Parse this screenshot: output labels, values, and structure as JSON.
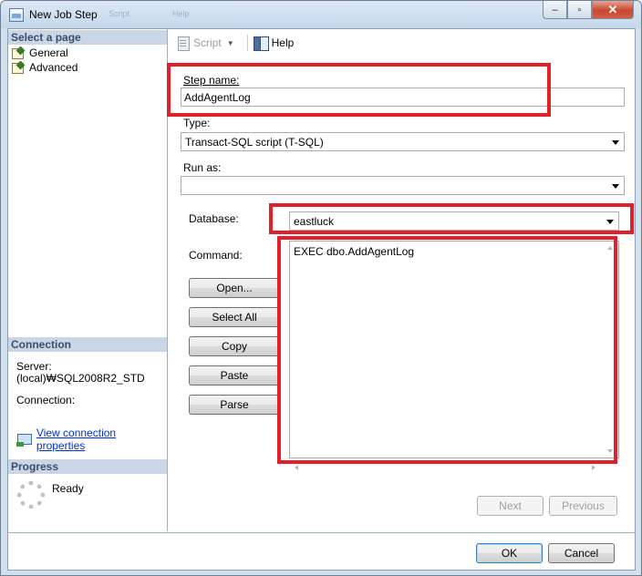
{
  "window": {
    "title": "New Job Step",
    "ghost_items": [
      "Script",
      "Help"
    ],
    "minimize_glyph": "–",
    "maximize_glyph": "▫",
    "close_glyph": "✕"
  },
  "left_panel": {
    "select_page_header": "Select a page",
    "pages": [
      {
        "label": "General",
        "icon": "page-settings-icon"
      },
      {
        "label": "Advanced",
        "icon": "page-settings-icon"
      }
    ],
    "connection_header": "Connection",
    "server_label": "Server:",
    "server_value": "(local)₩SQL2008R2_STD",
    "connection_label": "Connection:",
    "view_connection_link": "View connection properties",
    "progress_header": "Progress",
    "progress_status": "Ready"
  },
  "toolbar": {
    "script_label": "Script",
    "help_label": "Help"
  },
  "form": {
    "step_name_label": "Step name:",
    "step_name_value": "AddAgentLog",
    "type_label": "Type:",
    "type_value": "Transact-SQL script (T-SQL)",
    "run_as_label": "Run as:",
    "run_as_value": "",
    "database_label": "Database:",
    "database_value": "eastluck",
    "command_label": "Command:",
    "command_text": "EXEC dbo.AddAgentLog",
    "buttons": {
      "open": "Open...",
      "select_all": "Select All",
      "copy": "Copy",
      "paste": "Paste",
      "parse": "Parse"
    },
    "next": "Next",
    "previous": "Previous"
  },
  "footer": {
    "ok": "OK",
    "cancel": "Cancel"
  },
  "colors": {
    "highlight_red": "#e0202a",
    "section_header_bg": "#cad6e6",
    "link_blue": "#0033cc"
  }
}
